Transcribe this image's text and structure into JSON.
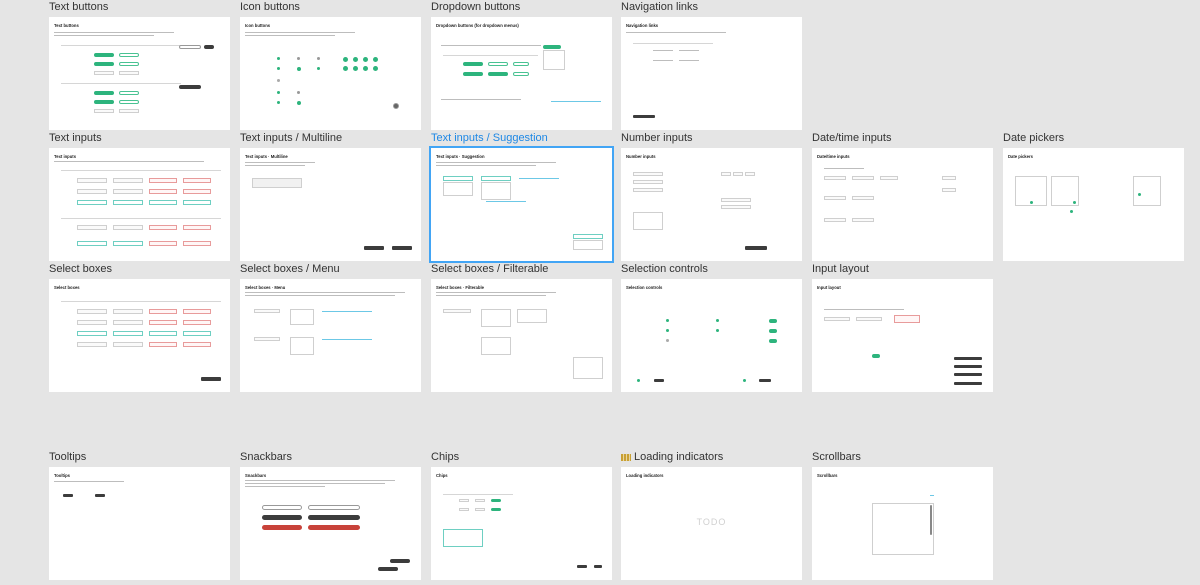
{
  "frames": [
    {
      "title": "Text buttons",
      "heading": "Text buttons"
    },
    {
      "title": "Icon buttons",
      "heading": "Icon buttons"
    },
    {
      "title": "Dropdown buttons",
      "heading": "Dropdown buttons (for dropdown menus)"
    },
    {
      "title": "Navigation links",
      "heading": "Navigation links"
    },
    {
      "title": "Text inputs",
      "heading": "Text inputs"
    },
    {
      "title": "Text inputs / Multiline",
      "heading": "Text inputs · Multiline"
    },
    {
      "title": "Text inputs / Suggestion",
      "heading": "Text inputs · Suggestion"
    },
    {
      "title": "Number inputs",
      "heading": "Number inputs"
    },
    {
      "title": "Date/time inputs",
      "heading": "Date/time inputs"
    },
    {
      "title": "Date pickers",
      "heading": "Date pickers"
    },
    {
      "title": "Select boxes",
      "heading": "Select boxes"
    },
    {
      "title": "Select boxes / Menu",
      "heading": "Select boxes · Menu"
    },
    {
      "title": "Select boxes / Filterable",
      "heading": "Select boxes · Filterable"
    },
    {
      "title": "Selection controls",
      "heading": "Selection controls"
    },
    {
      "title": "Input layout",
      "heading": "Input layout"
    },
    {
      "title": "Tooltips",
      "heading": "Tooltips"
    },
    {
      "title": "Snackbars",
      "heading": "Snackbars"
    },
    {
      "title": "Chips",
      "heading": "Chips"
    },
    {
      "title": "Loading indicators",
      "heading": "Loading indicators",
      "placeholder": "TODO"
    },
    {
      "title": "Scrollbars",
      "heading": "Scrollbars"
    }
  ],
  "selected_frame": "Text inputs / Suggestion",
  "colors": {
    "canvas": "#e5e5e5",
    "accent_green": "#2db47d",
    "selection_blue": "#42a5f5",
    "danger_red": "#c8423a"
  }
}
